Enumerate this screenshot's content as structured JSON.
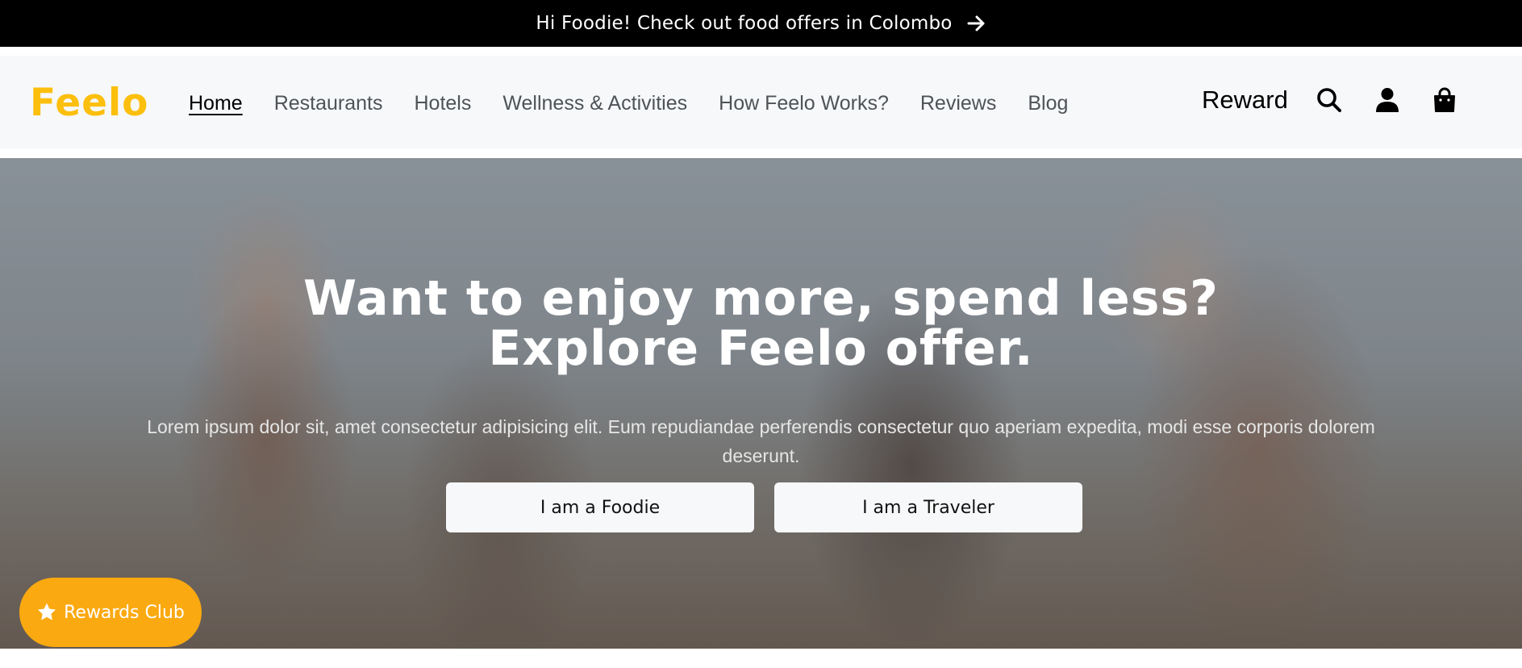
{
  "announcement": {
    "text": "Hi Foodie! Check out food offers in Colombo",
    "icon": "arrow-right-icon"
  },
  "header": {
    "logo_text": "Feelo",
    "nav": [
      {
        "label": "Home",
        "active": true
      },
      {
        "label": "Restaurants"
      },
      {
        "label": "Hotels"
      },
      {
        "label": "Wellness & Activities"
      },
      {
        "label": "How Feelo Works?"
      },
      {
        "label": "Reviews"
      },
      {
        "label": "Blog"
      }
    ],
    "reward_label": "Reward",
    "icons": [
      "search-icon",
      "user-icon",
      "shopping-bag-icon"
    ]
  },
  "hero": {
    "title_line1": "Want to enjoy more, spend less?",
    "title_line2": "Explore Feelo offer.",
    "description": "Lorem ipsum dolor sit, amet consectetur adipisicing elit. Eum repudiandae perferendis consectetur quo aperiam expedita, modi esse corporis dolorem deserunt.",
    "cta_foodie": "I am a Foodie",
    "cta_traveler": "I am a Traveler"
  },
  "rewards_club": {
    "label": "Rewards Club",
    "icon": "star-icon"
  },
  "colors": {
    "brand_yellow": "#fcbf0e",
    "brand_orange": "#ff9a00",
    "rewards_button": "#fba910",
    "nav_background": "#f6f8fa",
    "announcement_background": "#000000"
  }
}
